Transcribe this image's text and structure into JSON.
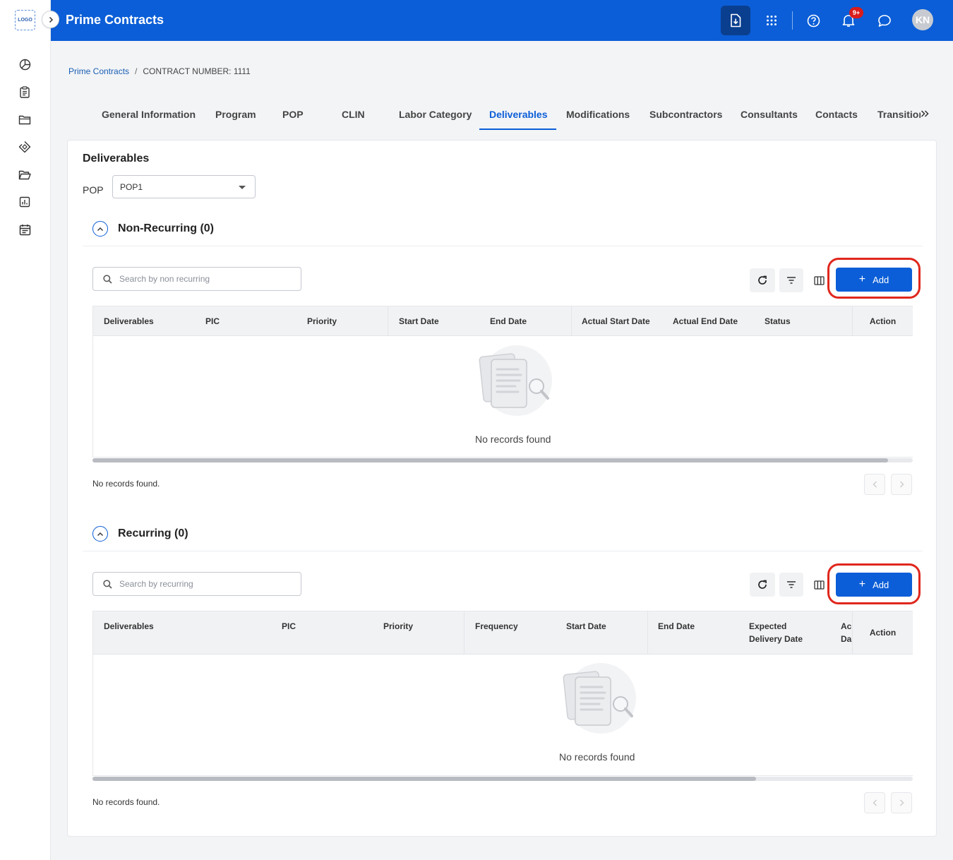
{
  "app": {
    "logo_text": "LOGO",
    "title": "Prime Contracts",
    "avatar_initials": "KN",
    "notification_count": "9+"
  },
  "sidebar": {
    "items": [
      "dashboard-icon",
      "clipboard-icon",
      "folder-icon",
      "tag-icon",
      "folder-open-icon",
      "report-icon",
      "calendar-icon"
    ]
  },
  "breadcrumb": {
    "root": "Prime Contracts",
    "separator": "/",
    "current": "CONTRACT NUMBER: 1111"
  },
  "tabs": [
    {
      "label": "General Information"
    },
    {
      "label": "Program"
    },
    {
      "label": "POP"
    },
    {
      "label": "CLIN"
    },
    {
      "label": "Labor Category"
    },
    {
      "label": "Deliverables"
    },
    {
      "label": "Modifications"
    },
    {
      "label": "Subcontractors"
    },
    {
      "label": "Consultants"
    },
    {
      "label": "Contacts"
    },
    {
      "label": "Transition:"
    }
  ],
  "active_tab": "Deliverables",
  "card": {
    "title": "Deliverables",
    "pop_label": "POP",
    "pop_value": "POP1"
  },
  "non_recurring": {
    "title": "Non-Recurring (0)",
    "search_placeholder": "Search by non recurring",
    "add_label": "Add",
    "columns": [
      "Deliverables",
      "PIC",
      "Priority",
      "Start Date",
      "End Date",
      "Actual Start Date",
      "Actual End Date",
      "Status"
    ],
    "action_label": "Action",
    "empty_text": "No records found",
    "footer_text": "No records found."
  },
  "recurring": {
    "title": "Recurring (0)",
    "search_placeholder": "Search by recurring",
    "add_label": "Add",
    "columns": [
      "Deliverables",
      "PIC",
      "Priority",
      "Frequency",
      "Start Date",
      "End Date",
      "Expected Delivery Date",
      "Ac Da"
    ],
    "action_label": "Action",
    "empty_text": "No records found",
    "footer_text": "No records found."
  },
  "colors": {
    "primary": "#0b5ed7",
    "highlight": "#e0271d",
    "badge": "#d91c1c"
  }
}
